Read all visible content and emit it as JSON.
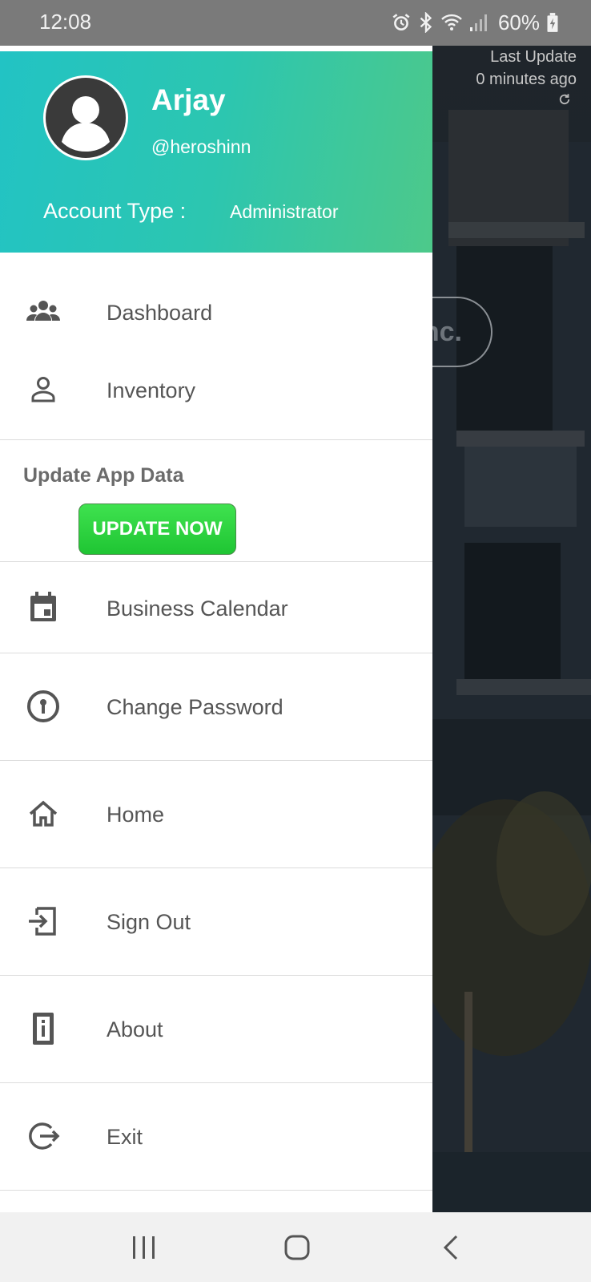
{
  "status_bar": {
    "time": "12:08",
    "battery": "60%",
    "icons": [
      "alarm-icon",
      "bluetooth-icon",
      "wifi-icon",
      "signal-icon",
      "battery-icon"
    ]
  },
  "background": {
    "last_update_label": "Last Update",
    "last_update_value": "0 minutes ago",
    "company_fragment": "nc."
  },
  "drawer": {
    "header": {
      "name": "Arjay",
      "handle": "@heroshinn",
      "account_type_label": "Account Type :",
      "account_type_value": "Administrator"
    },
    "items": [
      {
        "label": "Dashboard",
        "icon": "group-icon"
      },
      {
        "label": "Inventory",
        "icon": "person-icon"
      },
      {
        "label": "Business Calendar",
        "icon": "calendar-icon"
      },
      {
        "label": "Change Password",
        "icon": "password-icon"
      },
      {
        "label": "Home",
        "icon": "home-icon"
      },
      {
        "label": "Sign Out",
        "icon": "sign-out-icon"
      },
      {
        "label": "About",
        "icon": "info-icon"
      },
      {
        "label": "Exit",
        "icon": "exit-icon"
      }
    ],
    "update_section": {
      "title": "Update App Data",
      "button": "UPDATE NOW"
    }
  },
  "colors": {
    "header_start": "#22c3c4",
    "header_end": "#4dc98a",
    "update_button": "#2fd240",
    "menu_text": "#555555",
    "icon": "#555555"
  },
  "nav_bar": {
    "buttons": [
      "recents-icon",
      "home-circle-icon",
      "back-icon"
    ]
  }
}
